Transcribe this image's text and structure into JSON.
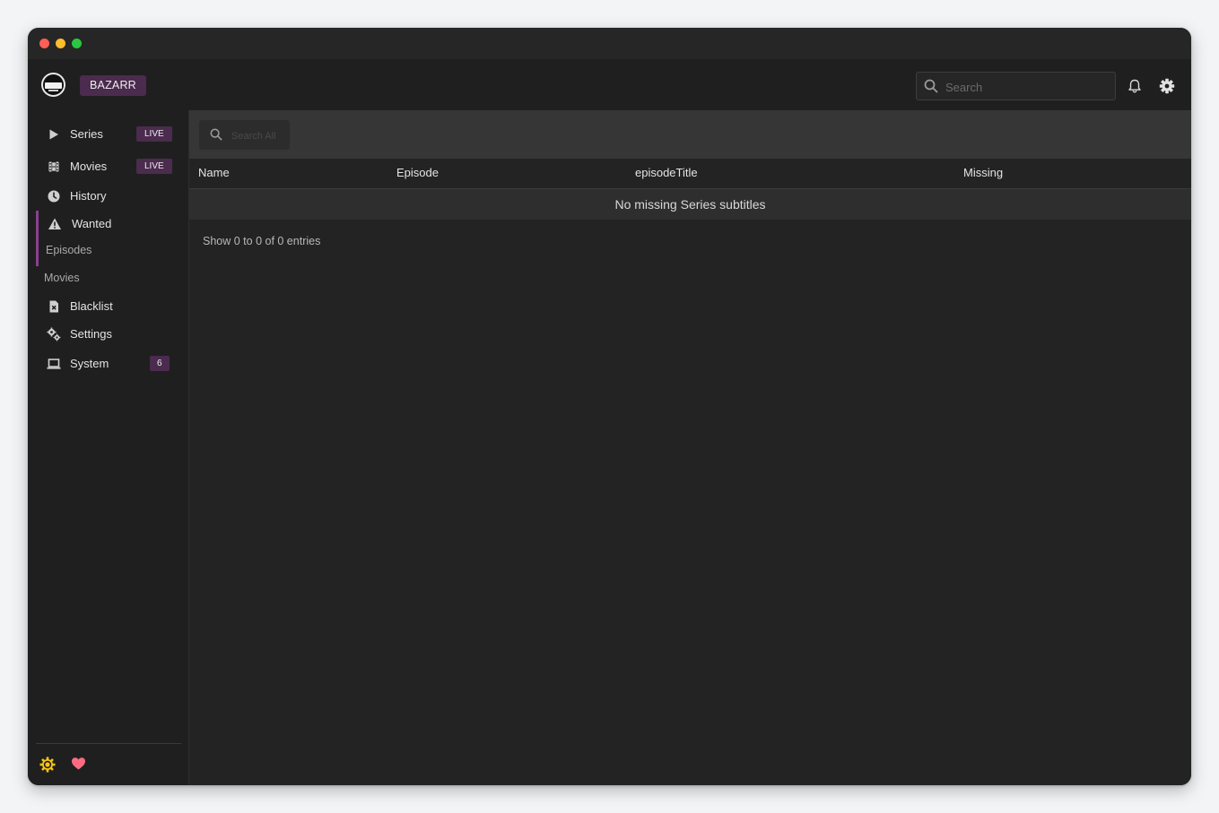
{
  "window": {
    "traffic_lights": [
      "close",
      "minimize",
      "zoom"
    ]
  },
  "header": {
    "brand_label": "BAZARR",
    "search_placeholder": "Search",
    "icons": [
      "search-icon",
      "bell-icon",
      "gear-icon"
    ]
  },
  "sidebar": {
    "items": [
      {
        "label": "Series",
        "badge": "LIVE",
        "icon": "play-icon"
      },
      {
        "label": "Movies",
        "badge": "LIVE",
        "icon": "film-icon"
      },
      {
        "label": "History",
        "icon": "clock-icon"
      },
      {
        "label": "Wanted",
        "icon": "warning-icon",
        "active": true
      },
      {
        "label": "Episodes",
        "sub": true
      },
      {
        "label": "Movies",
        "sub": true
      },
      {
        "label": "Blacklist",
        "icon": "file-x-icon"
      },
      {
        "label": "Settings",
        "icon": "cogs-icon"
      },
      {
        "label": "System",
        "badge": "6",
        "icon": "laptop-icon"
      }
    ],
    "footer_icons": [
      "sun-gear-icon",
      "heart-icon"
    ]
  },
  "main": {
    "search_all_placeholder": "Search All",
    "table": {
      "columns": [
        "Name",
        "Episode",
        "episodeTitle",
        "Missing"
      ],
      "empty_message": "No missing Series subtitles"
    },
    "entries_text": "Show 0 to 0 of 0 entries"
  },
  "colors": {
    "accent": "#4b2b4e",
    "active_indicator": "#8a3f8f",
    "background": "#232323",
    "sidebar": "#1f1f1f",
    "heart": "#ff6b81",
    "sun": "#f5c518"
  }
}
